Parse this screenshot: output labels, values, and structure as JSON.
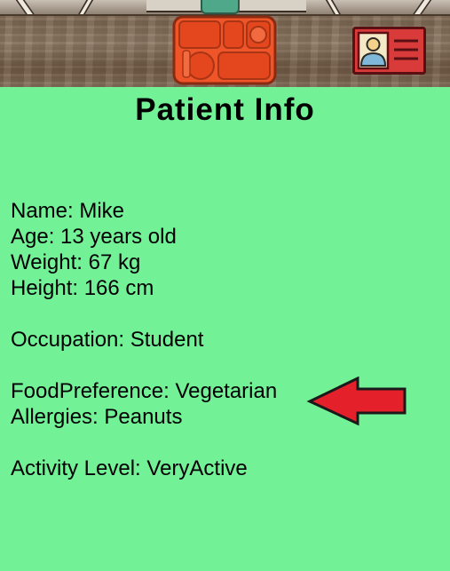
{
  "header": {
    "tray_icon": "lunch-tray-icon",
    "card_icon": "patient-card-icon"
  },
  "title": "Patient Info",
  "patient": {
    "name": "Name: Mike",
    "age": "Age: 13 years old",
    "weight": "Weight: 67 kg",
    "height": "Height: 166 cm",
    "occupation": "Occupation: Student",
    "food_preference": "FoodPreference: Vegetarian",
    "allergies": "Allergies: Peanuts",
    "activity_level": "Activity Level: VeryActive"
  },
  "colors": {
    "background": "#73f196",
    "tray": "#f0552a",
    "card": "#d93a3a",
    "arrow": "#e4202a"
  }
}
